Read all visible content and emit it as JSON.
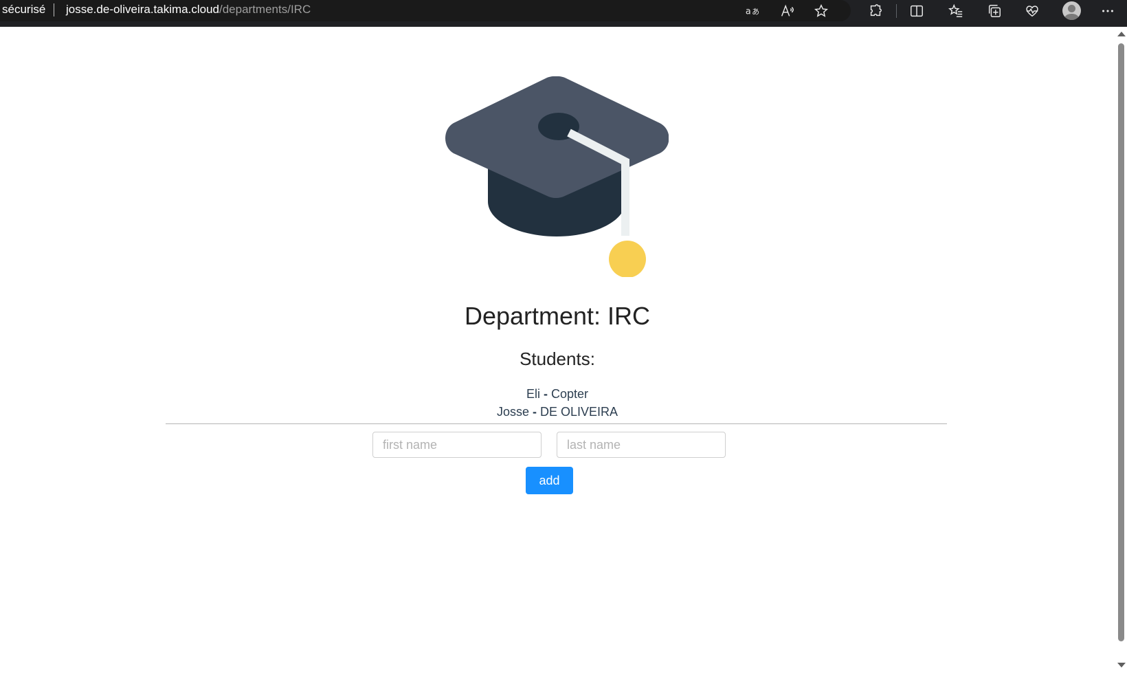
{
  "browser": {
    "security_label": "sécurisé",
    "url_host": "josse.de-oliveira.takima.cloud",
    "url_path": "/departments/IRC",
    "icons": [
      "translate-icon",
      "read-aloud-icon",
      "favorite-star-icon",
      "extensions-icon",
      "split-screen-icon",
      "favorites-icon",
      "collections-icon",
      "browser-health-icon",
      "profile-avatar-icon",
      "more-menu-icon"
    ]
  },
  "page": {
    "logo": "graduation-cap-icon",
    "title": "Department: IRC",
    "students_heading": "Students:",
    "students": [
      {
        "first": "Eli",
        "separator": "-",
        "last": "Copter"
      },
      {
        "first": "Josse",
        "separator": "-",
        "last": "DE OLIVEIRA"
      }
    ],
    "form": {
      "first_name_placeholder": "first name",
      "last_name_placeholder": "last name",
      "add_label": "add"
    },
    "colors": {
      "accent": "#1890ff",
      "cap_top": "#4b5566",
      "cap_base": "#22313f",
      "tassel": "#f8cf52"
    }
  }
}
